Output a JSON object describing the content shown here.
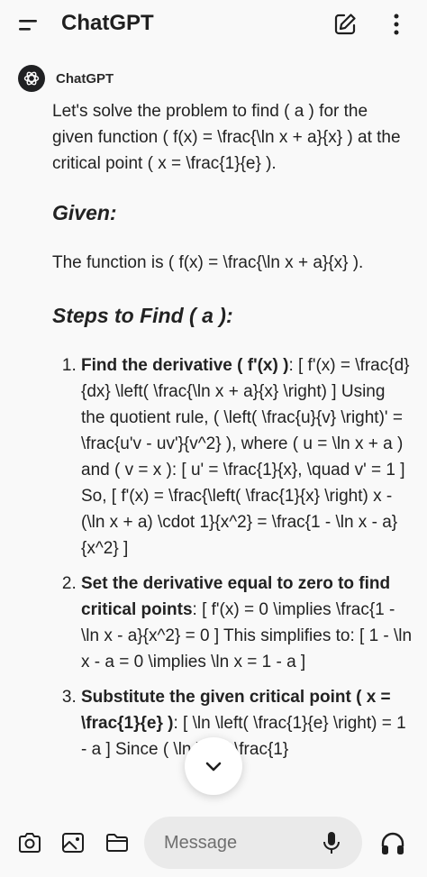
{
  "header": {
    "title": "ChatGPT",
    "menu_icon": "menu-icon",
    "edit_icon": "new-chat-icon",
    "more_icon": "more-vertical-icon"
  },
  "message": {
    "sender": "ChatGPT",
    "intro": "Let's solve the problem to find ( a ) for the given function ( f(x) = \\frac{\\ln x + a}{x} ) at the critical point ( x = \\frac{1}{e} ).",
    "given_heading": "Given:",
    "given_text": "The function is ( f(x) = \\frac{\\ln x + a}{x} ).",
    "steps_heading": "Steps to Find ( a ):",
    "steps": [
      {
        "bold": "Find the derivative ( f'(x) )",
        "text": ": [ f'(x) = \\frac{d}{dx} \\left( \\frac{\\ln x + a}{x} \\right) ] Using the quotient rule, ( \\left( \\frac{u}{v} \\right)' = \\frac{u'v - uv'}{v^2} ), where ( u = \\ln x + a ) and ( v = x ): [ u' = \\frac{1}{x}, \\quad v' = 1 ] So, [ f'(x) = \\frac{\\left( \\frac{1}{x} \\right) x - (\\ln x + a) \\cdot 1}{x^2} = \\frac{1 - \\ln x - a}{x^2} ]"
      },
      {
        "bold": "Set the derivative equal to zero to find critical points",
        "text": ": [ f'(x) = 0 \\implies \\frac{1 - \\ln x - a}{x^2} = 0 ] This simplifies to: [ 1 - \\ln x - a = 0 \\implies \\ln x = 1 - a ]"
      },
      {
        "bold": "Substitute the given critical point ( x = \\frac{1}{e} )",
        "text": ": [ \\ln \\left( \\frac{1}{e} \\right) = 1 - a ] Since ( \\ln \\left( \\frac{1}"
      }
    ]
  },
  "composer": {
    "placeholder": "Message",
    "camera_icon": "camera-icon",
    "image_icon": "image-icon",
    "folder_icon": "folder-icon",
    "mic_icon": "microphone-icon",
    "voice_icon": "headphones-icon"
  },
  "scroll_button_icon": "chevron-down-icon"
}
